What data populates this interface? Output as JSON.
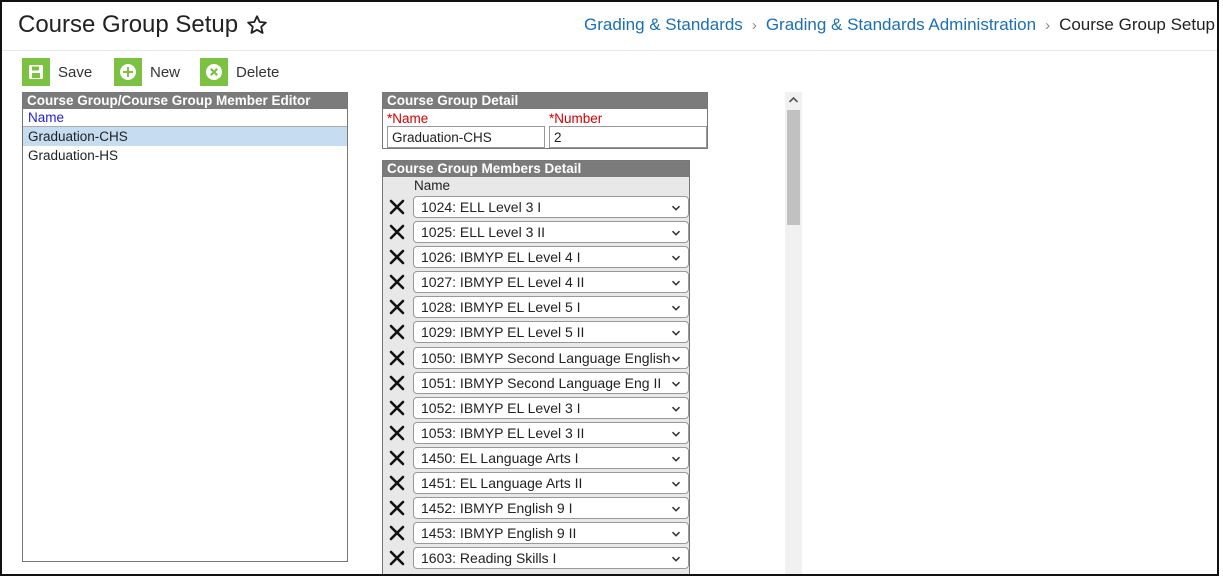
{
  "header": {
    "title": "Course Group Setup",
    "breadcrumbs": [
      {
        "label": "Grading & Standards"
      },
      {
        "label": "Grading & Standards Administration"
      },
      {
        "label": "Course Group Setup"
      }
    ]
  },
  "toolbar": {
    "save_label": "Save",
    "new_label": "New",
    "delete_label": "Delete"
  },
  "editor": {
    "title": "Course Group/Course Group Member Editor",
    "column": "Name",
    "items": [
      {
        "label": "Graduation-CHS",
        "selected": true
      },
      {
        "label": "Graduation-HS",
        "selected": false
      }
    ]
  },
  "detail": {
    "title": "Course Group Detail",
    "name_label": "*Name",
    "name_value": "Graduation-CHS",
    "number_label": "*Number",
    "number_value": "2"
  },
  "members": {
    "title": "Course Group Members Detail",
    "column": "Name",
    "items": [
      "1024: ELL Level 3 I",
      "1025: ELL Level 3 II",
      "1026: IBMYP EL Level 4 I",
      "1027: IBMYP EL Level 4 II",
      "1028: IBMYP EL Level 5 I",
      "1029: IBMYP EL Level 5 II",
      "1050: IBMYP Second Language English",
      "1051: IBMYP Second Language Eng II",
      "1052: IBMYP EL Level 3 I",
      "1053: IBMYP EL Level 3 II",
      "1450: EL Language Arts I",
      "1451: EL Language Arts II",
      "1452: IBMYP English 9 I",
      "1453: IBMYP English 9 II",
      "1603: Reading Skills I"
    ]
  },
  "colors": {
    "accent_green": "#7cc242",
    "link_blue": "#1a6fb5",
    "panel_header": "#7b7b7b",
    "selection": "#c6dcf0",
    "required_red": "#d40000"
  }
}
